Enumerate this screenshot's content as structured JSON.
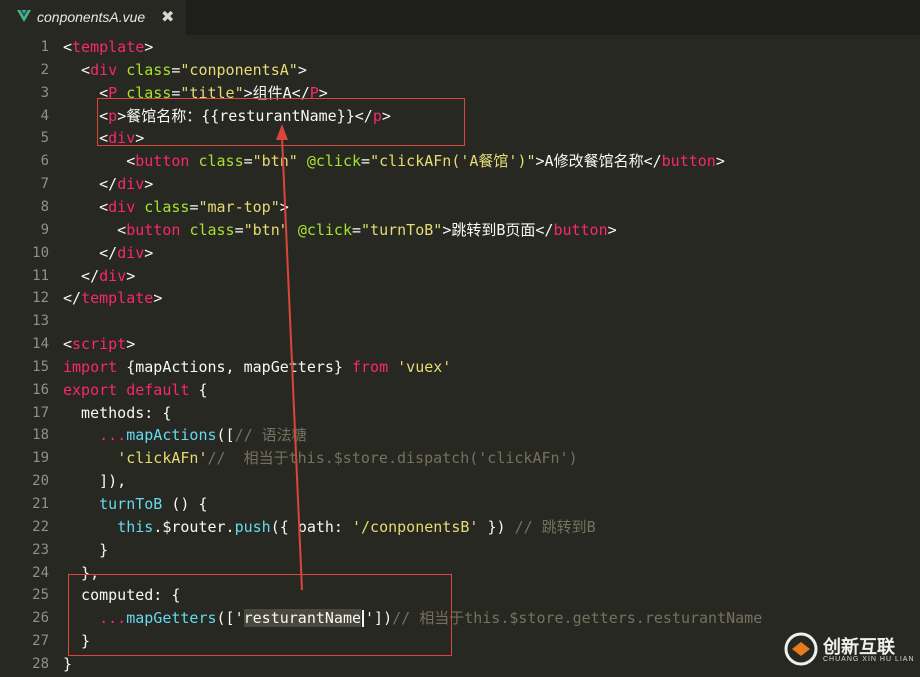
{
  "tab": {
    "title": "conponentsA.vue",
    "close_glyph": "✖",
    "icon": "vue-logo-icon"
  },
  "colors": {
    "background": "#272822",
    "tag": "#f92672",
    "attr": "#a6e22e",
    "string": "#e6db74",
    "text": "#f8f8f2",
    "comment": "#75715e",
    "function": "#66d9ef",
    "annotation": "#d8463c"
  },
  "code_lines": [
    {
      "n": "1",
      "tokens": [
        [
          "p",
          "<"
        ],
        [
          "t",
          "template"
        ],
        [
          "p",
          ">"
        ]
      ]
    },
    {
      "n": "2",
      "tokens": [
        [
          "p",
          "  <"
        ],
        [
          "t",
          "div"
        ],
        [
          "p",
          " "
        ],
        [
          "a",
          "class"
        ],
        [
          "p",
          "="
        ],
        [
          "s",
          "\"conponentsA\""
        ],
        [
          "p",
          ">"
        ]
      ]
    },
    {
      "n": "3",
      "tokens": [
        [
          "p",
          "    <"
        ],
        [
          "t",
          "P"
        ],
        [
          "p",
          " "
        ],
        [
          "a",
          "class"
        ],
        [
          "p",
          "="
        ],
        [
          "s",
          "\"title\""
        ],
        [
          "p",
          ">组件A</"
        ],
        [
          "t",
          "P"
        ],
        [
          "p",
          ">"
        ]
      ]
    },
    {
      "n": "4",
      "tokens": [
        [
          "p",
          "    <"
        ],
        [
          "t",
          "p"
        ],
        [
          "p",
          ">餐馆名称：{{resturantName}}</"
        ],
        [
          "t",
          "p"
        ],
        [
          "p",
          ">"
        ]
      ]
    },
    {
      "n": "5",
      "tokens": [
        [
          "p",
          "    <"
        ],
        [
          "t",
          "div"
        ],
        [
          "p",
          ">"
        ]
      ]
    },
    {
      "n": "6",
      "tokens": [
        [
          "p",
          "       <"
        ],
        [
          "t",
          "button"
        ],
        [
          "p",
          " "
        ],
        [
          "a",
          "class"
        ],
        [
          "p",
          "="
        ],
        [
          "s",
          "\"btn\""
        ],
        [
          "p",
          " "
        ],
        [
          "a",
          "@click"
        ],
        [
          "p",
          "="
        ],
        [
          "s",
          "\"clickAFn('A餐馆')\""
        ],
        [
          "p",
          ">A修改餐馆名称</"
        ],
        [
          "t",
          "button"
        ],
        [
          "p",
          ">"
        ]
      ]
    },
    {
      "n": "7",
      "tokens": [
        [
          "p",
          "    </"
        ],
        [
          "t",
          "div"
        ],
        [
          "p",
          ">"
        ]
      ]
    },
    {
      "n": "8",
      "tokens": [
        [
          "p",
          "    <"
        ],
        [
          "t",
          "div"
        ],
        [
          "p",
          " "
        ],
        [
          "a",
          "class"
        ],
        [
          "p",
          "="
        ],
        [
          "s",
          "\"mar-top\""
        ],
        [
          "p",
          ">"
        ]
      ]
    },
    {
      "n": "9",
      "tokens": [
        [
          "p",
          "      <"
        ],
        [
          "t",
          "button"
        ],
        [
          "p",
          " "
        ],
        [
          "a",
          "class"
        ],
        [
          "p",
          "="
        ],
        [
          "s",
          "\"btn\""
        ],
        [
          "p",
          " "
        ],
        [
          "a",
          "@click"
        ],
        [
          "p",
          "="
        ],
        [
          "s",
          "\"turnToB\""
        ],
        [
          "p",
          ">跳转到B页面</"
        ],
        [
          "t",
          "button"
        ],
        [
          "p",
          ">"
        ]
      ]
    },
    {
      "n": "10",
      "tokens": [
        [
          "p",
          "    </"
        ],
        [
          "t",
          "div"
        ],
        [
          "p",
          ">"
        ]
      ]
    },
    {
      "n": "11",
      "tokens": [
        [
          "p",
          "  </"
        ],
        [
          "t",
          "div"
        ],
        [
          "p",
          ">"
        ]
      ]
    },
    {
      "n": "12",
      "tokens": [
        [
          "p",
          "</"
        ],
        [
          "t",
          "template"
        ],
        [
          "p",
          ">"
        ]
      ]
    },
    {
      "n": "13",
      "tokens": []
    },
    {
      "n": "14",
      "tokens": [
        [
          "p",
          "<"
        ],
        [
          "t",
          "script"
        ],
        [
          "p",
          ">"
        ]
      ]
    },
    {
      "n": "15",
      "tokens": [
        [
          "t",
          "import"
        ],
        [
          "p",
          " {mapActions, mapGetters} "
        ],
        [
          "t",
          "from"
        ],
        [
          "p",
          " "
        ],
        [
          "s",
          "'vuex'"
        ]
      ]
    },
    {
      "n": "16",
      "tokens": [
        [
          "t",
          "export"
        ],
        [
          "p",
          " "
        ],
        [
          "t",
          "default"
        ],
        [
          "p",
          " {"
        ]
      ]
    },
    {
      "n": "17",
      "tokens": [
        [
          "p",
          "  methods: {"
        ]
      ]
    },
    {
      "n": "18",
      "tokens": [
        [
          "p",
          "    "
        ],
        [
          "t",
          "..."
        ],
        [
          "f",
          "mapActions"
        ],
        [
          "p",
          "(["
        ],
        [
          "c",
          "// 语法糖"
        ]
      ]
    },
    {
      "n": "19",
      "tokens": [
        [
          "p",
          "      "
        ],
        [
          "s",
          "'clickAFn'"
        ],
        [
          "c",
          "//  相当于this.$store.dispatch('clickAFn')"
        ]
      ]
    },
    {
      "n": "20",
      "tokens": [
        [
          "p",
          "    ]),"
        ]
      ]
    },
    {
      "n": "21",
      "tokens": [
        [
          "p",
          "    "
        ],
        [
          "f",
          "turnToB"
        ],
        [
          "p",
          " () {"
        ]
      ]
    },
    {
      "n": "22",
      "tokens": [
        [
          "p",
          "      "
        ],
        [
          "f",
          "this"
        ],
        [
          "p",
          ".$router."
        ],
        [
          "f",
          "push"
        ],
        [
          "p",
          "({ path: "
        ],
        [
          "s",
          "'/conponentsB'"
        ],
        [
          "p",
          " }) "
        ],
        [
          "c",
          "// 跳转到B"
        ]
      ]
    },
    {
      "n": "23",
      "tokens": [
        [
          "p",
          "    }"
        ]
      ]
    },
    {
      "n": "24",
      "tokens": [
        [
          "p",
          "  },"
        ]
      ]
    },
    {
      "n": "25",
      "tokens": [
        [
          "p",
          "  computed: {"
        ]
      ]
    },
    {
      "n": "26",
      "tokens": [
        [
          "p",
          "    "
        ],
        [
          "t",
          "..."
        ],
        [
          "f",
          "mapGetters"
        ],
        [
          "p",
          "(['"
        ],
        [
          "sel",
          "resturantName"
        ],
        [
          "caret",
          ""
        ],
        [
          "p",
          "'])"
        ],
        [
          "c",
          "// 相当于this.$store.getters.resturantName"
        ]
      ]
    },
    {
      "n": "27",
      "tokens": [
        [
          "p",
          "  }"
        ]
      ]
    },
    {
      "n": "28",
      "tokens": [
        [
          "p",
          "}"
        ]
      ]
    }
  ],
  "watermark": {
    "title": "创新互联",
    "subtitle": "CHUANG XIN HU LIAN",
    "icon": "brand-logo-icon"
  }
}
